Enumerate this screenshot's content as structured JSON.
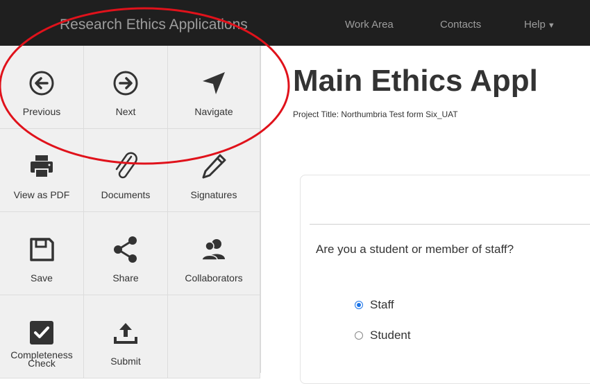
{
  "navbar": {
    "brand": "Research Ethics Applications",
    "links": [
      {
        "label": "Work Area"
      },
      {
        "label": "Contacts"
      },
      {
        "label": "Help"
      }
    ]
  },
  "toolbar": {
    "items": [
      {
        "label": "Previous",
        "icon": "arrow-left-circle-icon"
      },
      {
        "label": "Next",
        "icon": "arrow-right-circle-icon"
      },
      {
        "label": "Navigate",
        "icon": "navigate-arrow-icon"
      },
      {
        "label": "View as PDF",
        "icon": "printer-icon"
      },
      {
        "label": "Documents",
        "icon": "paperclip-icon"
      },
      {
        "label": "Signatures",
        "icon": "pencil-icon"
      },
      {
        "label": "Save",
        "icon": "floppy-disk-icon"
      },
      {
        "label": "Share",
        "icon": "share-icon"
      },
      {
        "label": "Collaborators",
        "icon": "users-icon"
      },
      {
        "label_line1": "Completeness",
        "label_line2": "Check",
        "icon": "checkbox-icon"
      },
      {
        "label": "Submit",
        "icon": "upload-icon"
      }
    ]
  },
  "main": {
    "title": "Main Ethics Appl",
    "project_title": "Project Title: Northumbria Test form Six_UAT",
    "question": "Are you a student or member of staff?",
    "options": [
      {
        "label": "Staff",
        "selected": true
      },
      {
        "label": "Student",
        "selected": false
      }
    ]
  },
  "colors": {
    "navbar_bg": "#1f1f1f",
    "annotation": "#e0121b",
    "radio_selected": "#1a73e8"
  }
}
